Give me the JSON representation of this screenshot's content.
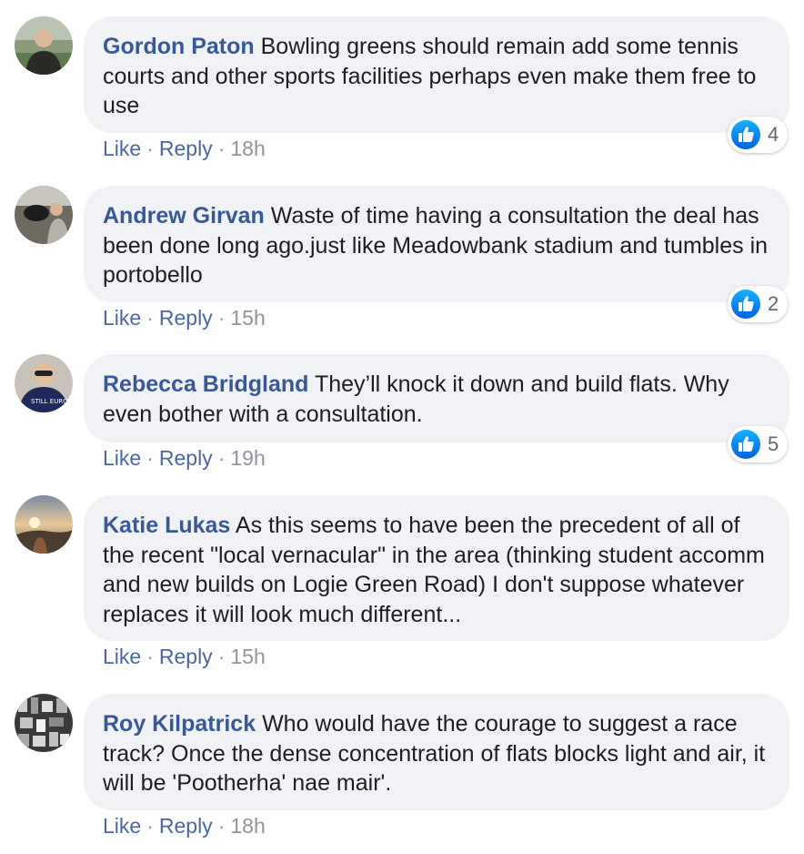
{
  "colors": {
    "author": "#385898",
    "action_link": "#4b67a1",
    "muted": "#90949c",
    "bubble": "#f0f2f5",
    "like_blue": "#1877f2"
  },
  "action_labels": {
    "like": "Like",
    "reply": "Reply",
    "separator": "·"
  },
  "comments": [
    {
      "author": "Gordon Paton",
      "text": "Bowling greens should remain add some tennis courts and other sports facilities perhaps even make them free to use",
      "time": "18h",
      "reaction_icon": "thumbs-up-icon",
      "likes": "4"
    },
    {
      "author": "Andrew Girvan",
      "text": "Waste of time having a consultation the deal has been done long ago.just like Meadowbank stadium and tumbles in portobello",
      "time": "15h",
      "reaction_icon": "thumbs-up-icon",
      "likes": "2"
    },
    {
      "author": "Rebecca Bridgland",
      "text": "They’ll knock it down and build flats. Why even bother with a consultation.",
      "time": "19h",
      "reaction_icon": "thumbs-up-icon",
      "likes": "5",
      "avatar_text": "STILL EUROPEAN"
    },
    {
      "author": "Katie Lukas",
      "text": "As this seems to have been the precedent of all of the recent \"local vernacular\" in the area (thinking student accomm and new builds on Logie Green Road) I don't suppose whatever replaces it will look much different...",
      "time": "15h"
    },
    {
      "author": "Roy Kilpatrick",
      "text": "Who would have the courage to suggest a race track? Once the dense concentration of flats blocks light and air, it will be 'Pootherha' nae mair'.",
      "time": "18h"
    }
  ]
}
